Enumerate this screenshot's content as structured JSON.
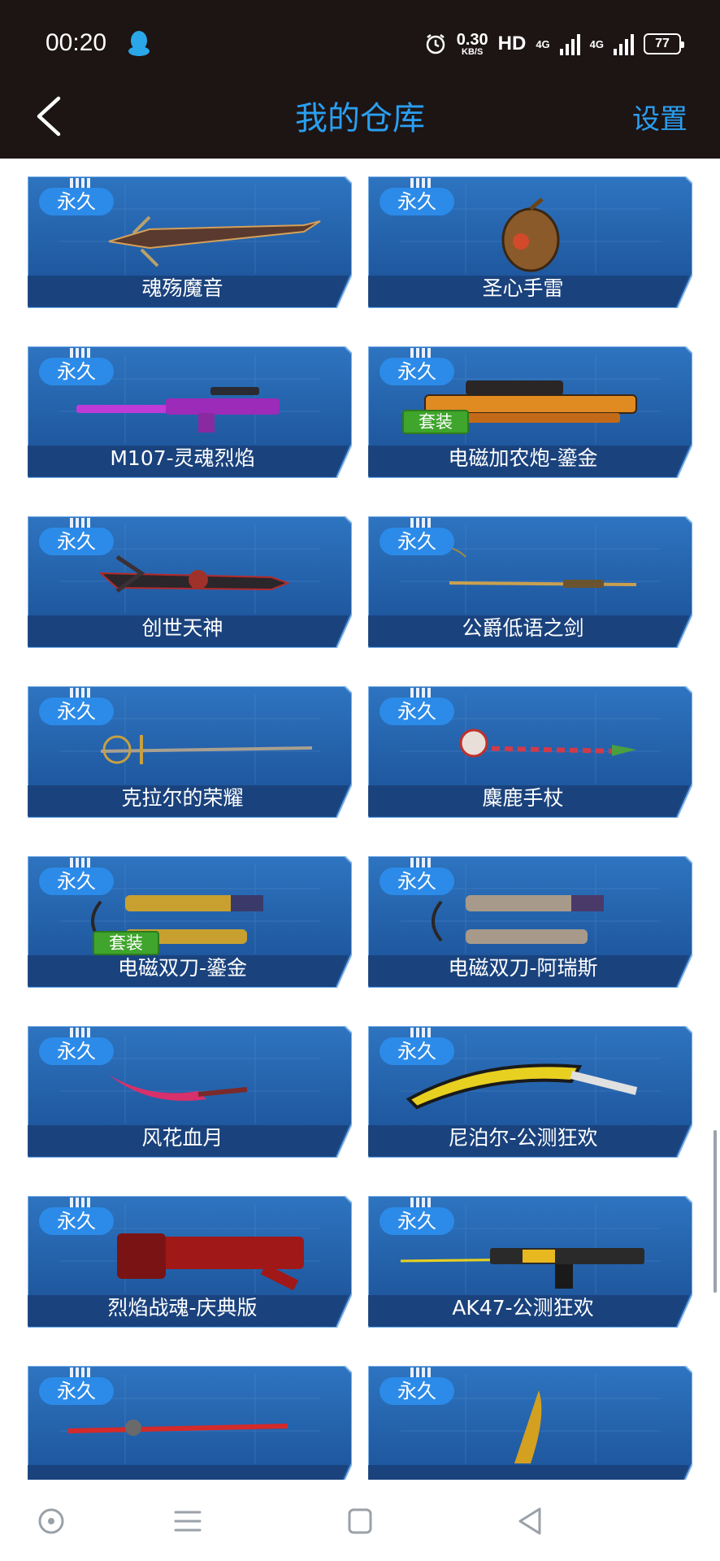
{
  "status_bar": {
    "time": "00:20",
    "speed_value": "0.30",
    "speed_unit": "KB/S",
    "hd_label": "HD",
    "net_1": "4G",
    "net_2": "4G",
    "battery": "77"
  },
  "header": {
    "title": "我的仓库",
    "settings_label": "设置"
  },
  "grid": {
    "duration_label": "永久",
    "suit_label": "套装",
    "items": [
      {
        "name": "魂殇魔音",
        "suit": false
      },
      {
        "name": "圣心手雷",
        "suit": false
      },
      {
        "name": "M107-灵魂烈焰",
        "suit": false
      },
      {
        "name": "电磁加农炮-鎏金",
        "suit": true
      },
      {
        "name": "创世天神",
        "suit": false
      },
      {
        "name": "公爵低语之剑",
        "suit": false
      },
      {
        "name": "克拉尔的荣耀",
        "suit": false
      },
      {
        "name": "麋鹿手杖",
        "suit": false
      },
      {
        "name": "电磁双刀-鎏金",
        "suit": true
      },
      {
        "name": "电磁双刀-阿瑞斯",
        "suit": false
      },
      {
        "name": "风花血月",
        "suit": false
      },
      {
        "name": "尼泊尔-公测狂欢",
        "suit": false
      },
      {
        "name": "烈焰战魂-庆典版",
        "suit": false
      },
      {
        "name": "AK47-公测狂欢",
        "suit": false
      },
      {
        "name": "",
        "suit": false
      },
      {
        "name": "",
        "suit": false
      }
    ]
  },
  "colors": {
    "accent": "#2a9ff0",
    "header_bg": "#1d1414",
    "card_bg": "#1f5fa8",
    "badge_bg": "#2c8be8",
    "suit_bg": "#3fa52c"
  },
  "icons": {
    "back": "back-arrow-icon",
    "qq": "qq-penguin-icon",
    "alarm": "alarm-icon",
    "nav_home": "circle-dot-icon",
    "nav_menu": "menu-icon",
    "nav_recent": "square-icon",
    "nav_back": "triangle-back-icon"
  }
}
